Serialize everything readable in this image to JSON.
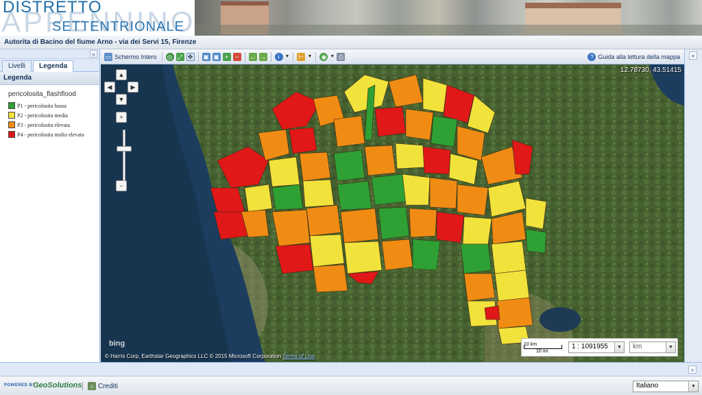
{
  "banner": {
    "logo_line1": "DISTRETTO",
    "logo_line2": "APPENNINO",
    "logo_line3": "SETTENTRIONALE"
  },
  "header": {
    "title": "Autorita di Bacino del fiume Arno - via dei Servi 15, Firenze"
  },
  "left_panel": {
    "collapse": "«",
    "tabs": [
      {
        "label": "Livelli",
        "active": false
      },
      {
        "label": "Legenda",
        "active": true
      }
    ],
    "legend_title": "Legenda",
    "layer_name": "pericolosita_flashflood",
    "legend_items": [
      {
        "label": "P1 - pericolosita bassa",
        "color": "#2ea034"
      },
      {
        "label": "P2 - pericolosita media",
        "color": "#f2e23c"
      },
      {
        "label": "P3 - pericolosita elevata",
        "color": "#f08c14"
      },
      {
        "label": "P4 - pericolosita molto elevata",
        "color": "#e01818"
      }
    ]
  },
  "toolbar": {
    "fullscreen_label": "Schermo Intero",
    "help_label": "Guida alla lettura della mappa"
  },
  "right_panel": {
    "collapse": "«"
  },
  "map": {
    "coordinates": "12.78730, 43.51415",
    "bing_logo": "bing",
    "credit": "© Harris Corp, Earthstar Geographics LLC © 2015 Microsoft Corporation",
    "credit_link": "Terms of Use",
    "scale_top": "10 km",
    "scale_bottom": "10 mi",
    "scale_value": "1 : 1091955",
    "unit_value": "km",
    "colors": {
      "low": "#2ea034",
      "medium": "#f2e23c",
      "high": "#f08c14",
      "very_high": "#e01818",
      "sea": "#1b3a5a"
    }
  },
  "footer": {
    "powered_by": "POWERED BY",
    "brand": "GeoSolutions",
    "credits_label": "Crediti",
    "language": "Italiano",
    "south_collapse": "»"
  }
}
